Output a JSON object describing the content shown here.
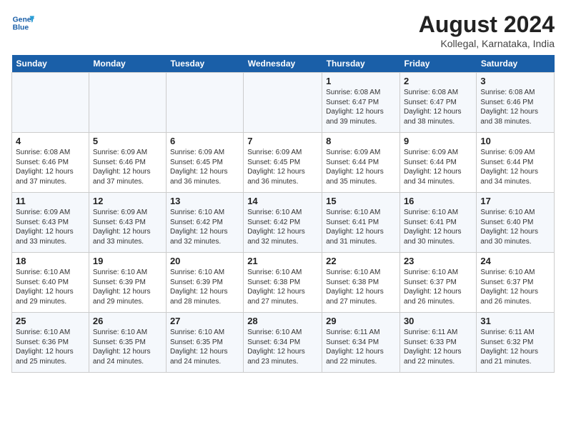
{
  "header": {
    "logo_line1": "General",
    "logo_line2": "Blue",
    "main_title": "August 2024",
    "subtitle": "Kollegal, Karnataka, India"
  },
  "days": [
    "Sunday",
    "Monday",
    "Tuesday",
    "Wednesday",
    "Thursday",
    "Friday",
    "Saturday"
  ],
  "weeks": [
    [
      {
        "date": "",
        "text": ""
      },
      {
        "date": "",
        "text": ""
      },
      {
        "date": "",
        "text": ""
      },
      {
        "date": "",
        "text": ""
      },
      {
        "date": "1",
        "text": "Sunrise: 6:08 AM\nSunset: 6:47 PM\nDaylight: 12 hours and 39 minutes."
      },
      {
        "date": "2",
        "text": "Sunrise: 6:08 AM\nSunset: 6:47 PM\nDaylight: 12 hours and 38 minutes."
      },
      {
        "date": "3",
        "text": "Sunrise: 6:08 AM\nSunset: 6:46 PM\nDaylight: 12 hours and 38 minutes."
      }
    ],
    [
      {
        "date": "4",
        "text": "Sunrise: 6:08 AM\nSunset: 6:46 PM\nDaylight: 12 hours and 37 minutes."
      },
      {
        "date": "5",
        "text": "Sunrise: 6:09 AM\nSunset: 6:46 PM\nDaylight: 12 hours and 37 minutes."
      },
      {
        "date": "6",
        "text": "Sunrise: 6:09 AM\nSunset: 6:45 PM\nDaylight: 12 hours and 36 minutes."
      },
      {
        "date": "7",
        "text": "Sunrise: 6:09 AM\nSunset: 6:45 PM\nDaylight: 12 hours and 36 minutes."
      },
      {
        "date": "8",
        "text": "Sunrise: 6:09 AM\nSunset: 6:44 PM\nDaylight: 12 hours and 35 minutes."
      },
      {
        "date": "9",
        "text": "Sunrise: 6:09 AM\nSunset: 6:44 PM\nDaylight: 12 hours and 34 minutes."
      },
      {
        "date": "10",
        "text": "Sunrise: 6:09 AM\nSunset: 6:44 PM\nDaylight: 12 hours and 34 minutes."
      }
    ],
    [
      {
        "date": "11",
        "text": "Sunrise: 6:09 AM\nSunset: 6:43 PM\nDaylight: 12 hours and 33 minutes."
      },
      {
        "date": "12",
        "text": "Sunrise: 6:09 AM\nSunset: 6:43 PM\nDaylight: 12 hours and 33 minutes."
      },
      {
        "date": "13",
        "text": "Sunrise: 6:10 AM\nSunset: 6:42 PM\nDaylight: 12 hours and 32 minutes."
      },
      {
        "date": "14",
        "text": "Sunrise: 6:10 AM\nSunset: 6:42 PM\nDaylight: 12 hours and 32 minutes."
      },
      {
        "date": "15",
        "text": "Sunrise: 6:10 AM\nSunset: 6:41 PM\nDaylight: 12 hours and 31 minutes."
      },
      {
        "date": "16",
        "text": "Sunrise: 6:10 AM\nSunset: 6:41 PM\nDaylight: 12 hours and 30 minutes."
      },
      {
        "date": "17",
        "text": "Sunrise: 6:10 AM\nSunset: 6:40 PM\nDaylight: 12 hours and 30 minutes."
      }
    ],
    [
      {
        "date": "18",
        "text": "Sunrise: 6:10 AM\nSunset: 6:40 PM\nDaylight: 12 hours and 29 minutes."
      },
      {
        "date": "19",
        "text": "Sunrise: 6:10 AM\nSunset: 6:39 PM\nDaylight: 12 hours and 29 minutes."
      },
      {
        "date": "20",
        "text": "Sunrise: 6:10 AM\nSunset: 6:39 PM\nDaylight: 12 hours and 28 minutes."
      },
      {
        "date": "21",
        "text": "Sunrise: 6:10 AM\nSunset: 6:38 PM\nDaylight: 12 hours and 27 minutes."
      },
      {
        "date": "22",
        "text": "Sunrise: 6:10 AM\nSunset: 6:38 PM\nDaylight: 12 hours and 27 minutes."
      },
      {
        "date": "23",
        "text": "Sunrise: 6:10 AM\nSunset: 6:37 PM\nDaylight: 12 hours and 26 minutes."
      },
      {
        "date": "24",
        "text": "Sunrise: 6:10 AM\nSunset: 6:37 PM\nDaylight: 12 hours and 26 minutes."
      }
    ],
    [
      {
        "date": "25",
        "text": "Sunrise: 6:10 AM\nSunset: 6:36 PM\nDaylight: 12 hours and 25 minutes."
      },
      {
        "date": "26",
        "text": "Sunrise: 6:10 AM\nSunset: 6:35 PM\nDaylight: 12 hours and 24 minutes."
      },
      {
        "date": "27",
        "text": "Sunrise: 6:10 AM\nSunset: 6:35 PM\nDaylight: 12 hours and 24 minutes."
      },
      {
        "date": "28",
        "text": "Sunrise: 6:10 AM\nSunset: 6:34 PM\nDaylight: 12 hours and 23 minutes."
      },
      {
        "date": "29",
        "text": "Sunrise: 6:11 AM\nSunset: 6:34 PM\nDaylight: 12 hours and 22 minutes."
      },
      {
        "date": "30",
        "text": "Sunrise: 6:11 AM\nSunset: 6:33 PM\nDaylight: 12 hours and 22 minutes."
      },
      {
        "date": "31",
        "text": "Sunrise: 6:11 AM\nSunset: 6:32 PM\nDaylight: 12 hours and 21 minutes."
      }
    ]
  ]
}
